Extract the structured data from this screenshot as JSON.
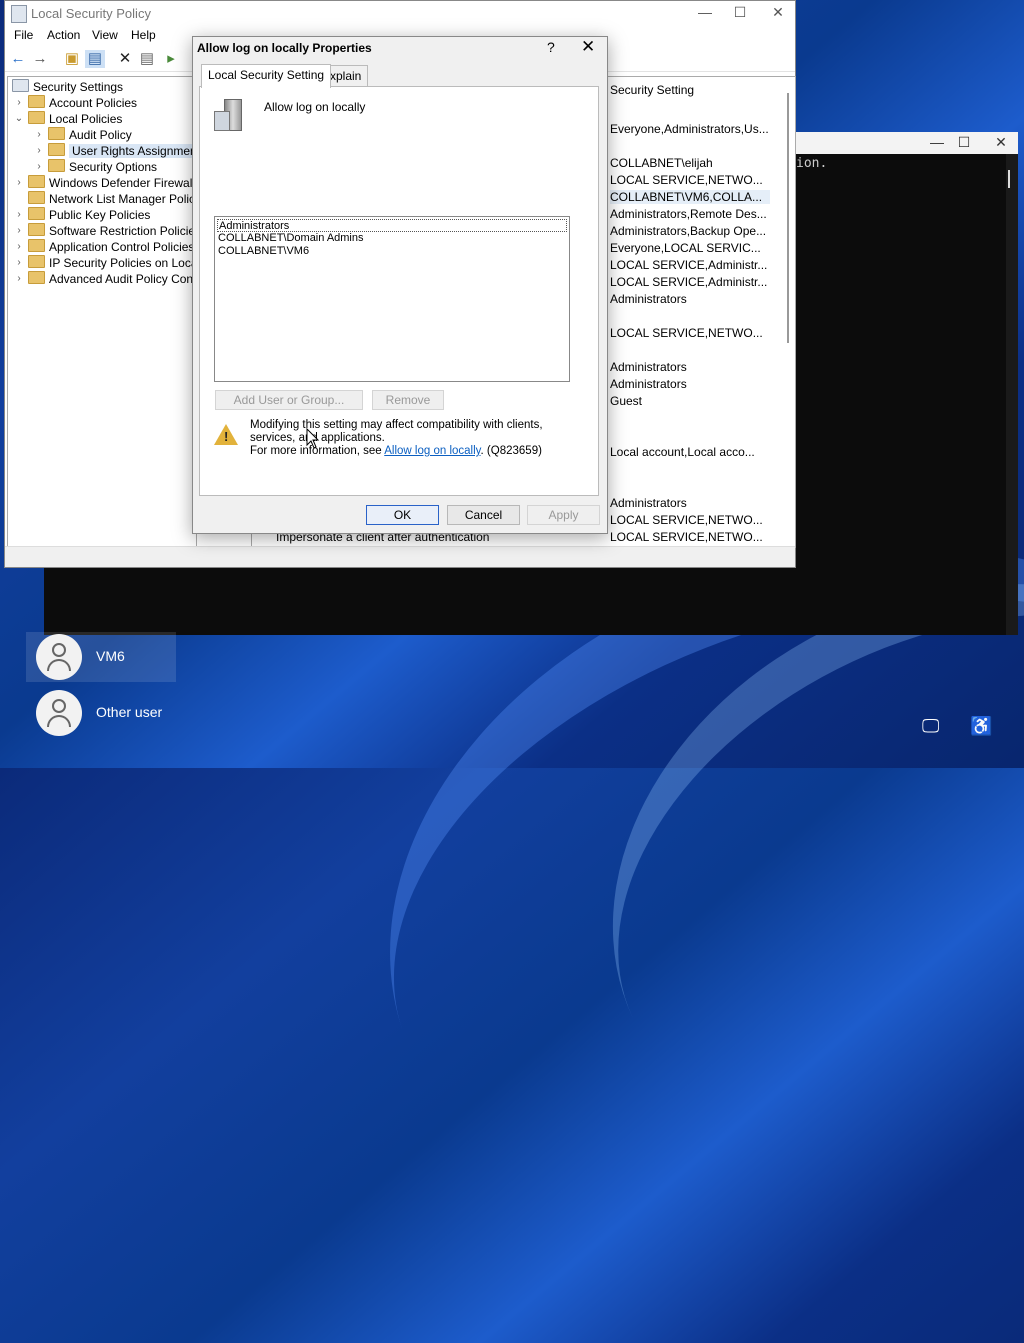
{
  "console": {
    "text": "ion.",
    "controls": [
      "—",
      "☐",
      "✕"
    ]
  },
  "mmc": {
    "title": "Local Security Policy",
    "controls": [
      "—",
      "☐",
      "✕"
    ],
    "menu": [
      "File",
      "Action",
      "View",
      "Help"
    ],
    "tree": [
      {
        "label": "Security Settings",
        "level": 0,
        "expander": ""
      },
      {
        "label": "Account Policies",
        "level": 1,
        "expander": "›"
      },
      {
        "label": "Local Policies",
        "level": 1,
        "expander": "⌄"
      },
      {
        "label": "Audit Policy",
        "level": 2,
        "expander": "›"
      },
      {
        "label": "User Rights Assignment",
        "level": 2,
        "expander": "›",
        "selected": true
      },
      {
        "label": "Security Options",
        "level": 2,
        "expander": "›"
      },
      {
        "label": "Windows Defender Firewall wit",
        "level": 1,
        "expander": "›"
      },
      {
        "label": "Network List Manager Policies",
        "level": 1,
        "expander": ""
      },
      {
        "label": "Public Key Policies",
        "level": 1,
        "expander": "›"
      },
      {
        "label": "Software Restriction Policies",
        "level": 1,
        "expander": "›"
      },
      {
        "label": "Application Control Policies",
        "level": 1,
        "expander": "›"
      },
      {
        "label": "IP Security Policies on Local C",
        "level": 1,
        "expander": "›"
      },
      {
        "label": "Advanced Audit Policy Configu",
        "level": 1,
        "expander": "›"
      }
    ],
    "column_security_setting": "Security Setting",
    "values": [
      "Everyone,Administrators,Us...",
      "COLLABNET\\elijah",
      "LOCAL SERVICE,NETWO...",
      "COLLABNET\\VM6,COLLA...",
      "Administrators,Remote Des...",
      "Administrators,Backup Ope...",
      "Everyone,LOCAL SERVIC...",
      "LOCAL SERVICE,Administr...",
      "LOCAL SERVICE,Administr...",
      "Administrators",
      "LOCAL SERVICE,NETWO...",
      "Administrators",
      "Administrators",
      "Guest",
      "Local account,Local acco...",
      "Administrators",
      "LOCAL SERVICE,NETWO...",
      "LOCAL SERVICE,NETWO..."
    ],
    "bottom_policy": "Impersonate a client after authentication"
  },
  "dialog": {
    "title": "Allow log on locally Properties",
    "help": "?",
    "close": "✕",
    "tabs": [
      "Local Security Setting",
      "Explain"
    ],
    "policy_name": "Allow log on locally",
    "members": [
      "Administrators",
      "COLLABNET\\Domain Admins",
      "COLLABNET\\VM6"
    ],
    "add_button": "Add User or Group...",
    "remove_button": "Remove",
    "warning_line1": "Modifying this setting may affect compatibility with clients, services, and applications.",
    "warning_prefix": "For more information, see ",
    "warning_link": "Allow log on locally",
    "warning_suffix": ". (Q823659)",
    "ok": "OK",
    "cancel": "Cancel",
    "apply": "Apply"
  },
  "lockscreen": {
    "users": [
      "VM6",
      "Other user"
    ]
  }
}
